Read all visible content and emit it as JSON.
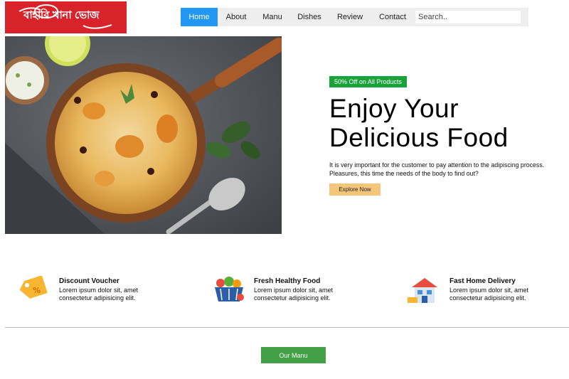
{
  "logo": {
    "text": "বাহারি খানা ভোজ",
    "bg_color": "#d8232a"
  },
  "nav": {
    "items": [
      {
        "label": "Home",
        "active": true
      },
      {
        "label": "About",
        "active": false
      },
      {
        "label": "Manu",
        "active": false
      },
      {
        "label": "Dishes",
        "active": false
      },
      {
        "label": "Review",
        "active": false
      },
      {
        "label": "Contact",
        "active": false
      }
    ],
    "search_placeholder": "Search..",
    "active_color": "#2196f3"
  },
  "hero": {
    "badge": "50% Off on All Products",
    "title_line1": "Enjoy Your",
    "title_line2": "Delicious Food",
    "description": "It is very important for the customer to pay attention to the adipiscing process. Pleasures, this time the needs of the body to find out?",
    "cta": "Explore Now"
  },
  "features": [
    {
      "icon": "voucher-tag-icon",
      "title": "Discount Voucher",
      "desc": "Lorem ipsum dolor sit, amet consectetur adipisicing elit."
    },
    {
      "icon": "basket-icon",
      "title": "Fresh Healthy Food",
      "desc": "Lorem ipsum dolor sit, amet consectetur adipisicing elit."
    },
    {
      "icon": "home-delivery-icon",
      "title": "Fast Home Delivery",
      "desc": "Lorem ipsum dolor sit, amet consectetur adipisicing elit."
    }
  ],
  "menu_button": "Our Manu",
  "colors": {
    "badge": "#19a33b",
    "cta": "#f5c57a",
    "menu_button": "#43a047"
  }
}
